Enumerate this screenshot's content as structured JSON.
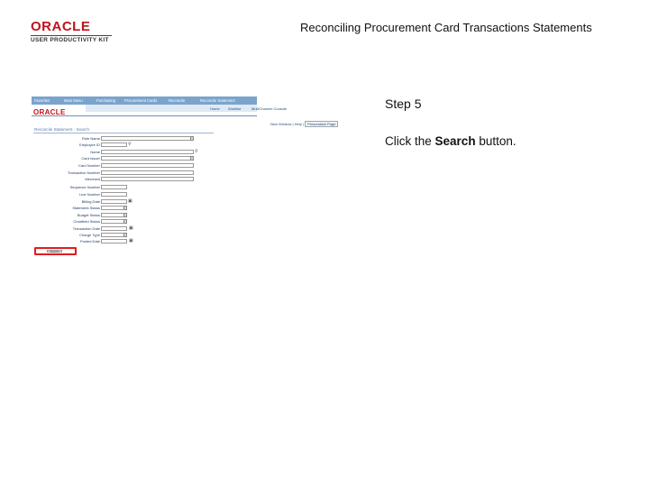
{
  "header": {
    "logo_brand": "ORACLE",
    "logo_tagline": "USER PRODUCTIVITY KIT",
    "title": "Reconciling Procurement Card Transactions Statements"
  },
  "step": {
    "label": "Step 5",
    "instruction_prefix": "Click the ",
    "instruction_target": "Search",
    "instruction_suffix": " button."
  },
  "screenshot": {
    "logo": "ORACLE",
    "nav": [
      "Favorites",
      "Main Menu",
      "Purchasing",
      "Procurement Cards",
      "Reconcile",
      "Reconcile Statement"
    ],
    "menu": [
      "Home",
      "Worklist",
      "MultiChannel Console",
      "Add to Favorites",
      "Sign out"
    ],
    "page_links": [
      "New Window",
      "Help",
      "Personalize Page"
    ],
    "page_title": "Reconcile Statement - Search",
    "fields": [
      "Role Name",
      "Employee ID",
      "Name",
      "Card Issuer",
      "Card Number",
      "Transaction Number",
      "Merchant",
      "Sequence Number",
      "Line Number",
      "Billing Date",
      "Statement Status",
      "Budget Status",
      "Chartfield Status",
      "Transaction Date",
      "Charge Type",
      "Posted Date"
    ],
    "search_button": "Search"
  }
}
